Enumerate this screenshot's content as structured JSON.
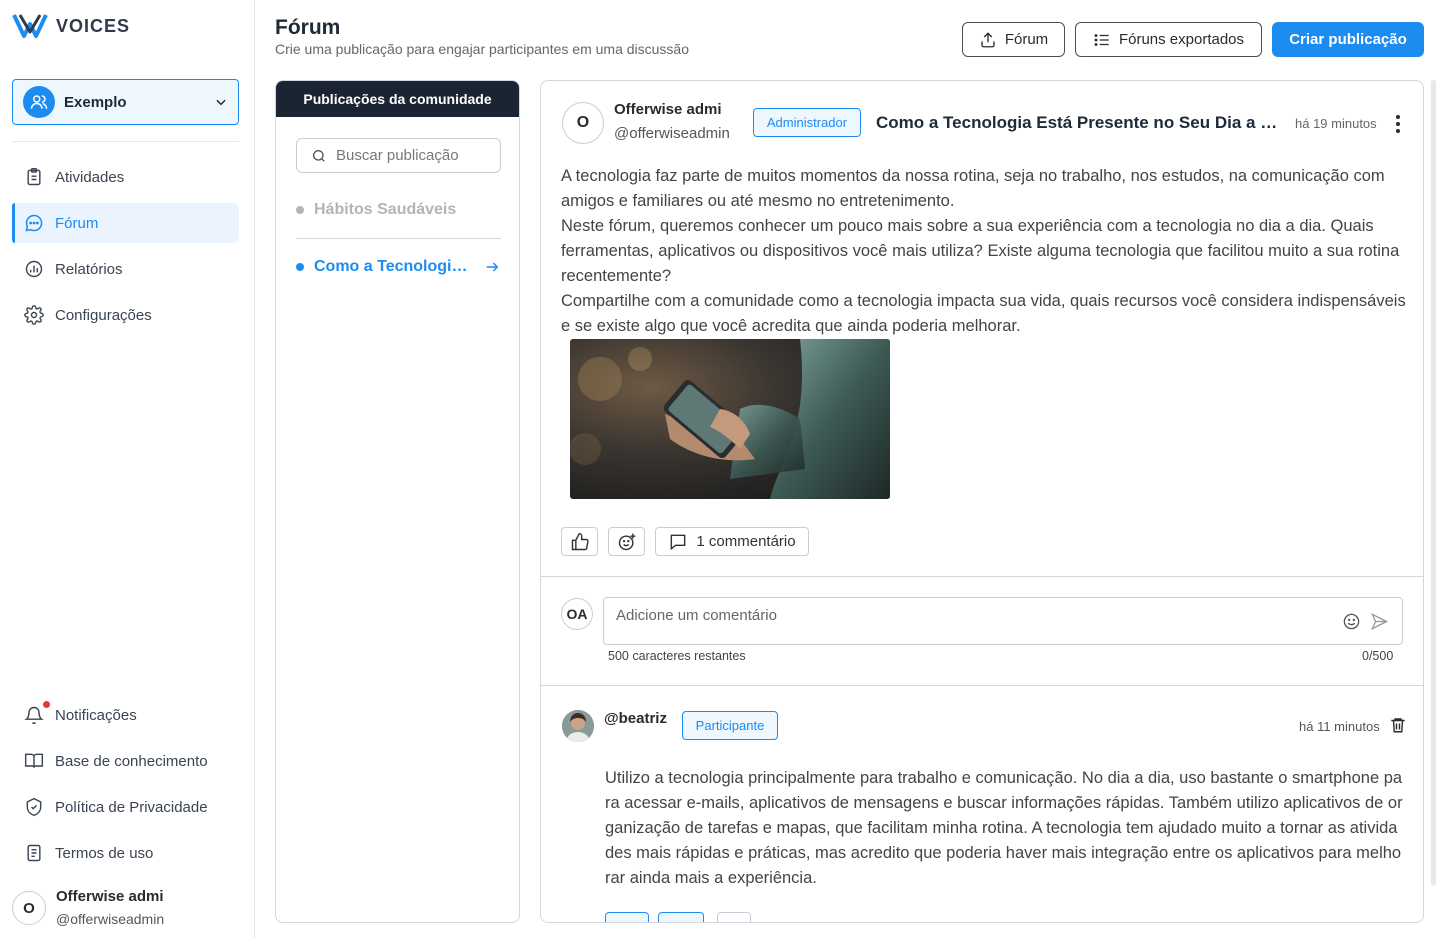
{
  "brand": {
    "name": "VOICES",
    "accent": "#1d8cf0",
    "dark": "#1b2433"
  },
  "sidebar": {
    "workspace": "Exemplo",
    "nav": [
      {
        "label": "Atividades",
        "icon": "clipboard-icon"
      },
      {
        "label": "Fórum",
        "icon": "chat-icon",
        "active": true
      },
      {
        "label": "Relatórios",
        "icon": "chart-icon"
      },
      {
        "label": "Configurações",
        "icon": "gear-icon"
      }
    ],
    "bottom_nav": [
      {
        "label": "Notificações",
        "icon": "bell-icon"
      },
      {
        "label": "Base de conhecimento",
        "icon": "book-icon"
      },
      {
        "label": "Política de Privacidade",
        "icon": "shield-icon"
      },
      {
        "label": "Termos de uso",
        "icon": "document-icon"
      }
    ],
    "user": {
      "initial": "O",
      "name": "Offerwise admi",
      "handle": "@offerwiseadmin"
    }
  },
  "header": {
    "title": "Fórum",
    "subtitle": "Crie uma publicação para engajar participantes em uma discussão",
    "buttons": {
      "export": "Fórum",
      "exported": "Fóruns exportados",
      "create": "Criar publicação"
    }
  },
  "list_panel": {
    "title": "Publicações da comunidade",
    "search_placeholder": "Buscar publicação",
    "items": [
      {
        "label": "Hábitos Saudáveis",
        "color": "#b0b5bc"
      },
      {
        "label": "Como a Tecnologia Está Presente no Seu Dia a Dia",
        "color": "#1d8cf0",
        "selected": true
      }
    ]
  },
  "post": {
    "avatar_initial": "O",
    "author": "Offerwise admi",
    "handle": "@offerwiseadmin",
    "badge": "Administrador",
    "title": "Como a Tecnologia Está Presente no Seu Dia a Dia",
    "time": "há 19 minutos",
    "body": [
      "A tecnologia faz parte de muitos momentos da nossa rotina, seja no trabalho, nos estudos, na comunicação com amigos e familiares ou até mesmo no entretenimento.",
      "Neste fórum, queremos conhecer um pouco mais sobre a sua experiência com a tecnologia no dia a dia. Quais ferramentas, aplicativos ou dispositivos você mais utiliza? Existe alguma tecnologia que facilitou muito a sua rotina recentemente?",
      "Compartilhe com a comunidade como a tecnologia impacta sua vida, quais recursos você considera indispensáveis e se existe algo que você acredita que ainda poderia melhorar."
    ],
    "comments_label": "1 commentário"
  },
  "composer": {
    "avatar_initials": "OA",
    "placeholder": "Adicione um comentário",
    "chars_left": "500 caracteres restantes",
    "count": "0/500"
  },
  "comment": {
    "author": "@beatriz",
    "badge": "Participante",
    "time": "há 11 minutos",
    "body": "Utilizo a tecnologia principalmente para trabalho e comunicação. No dia a dia, uso bastante o smartphone para acessar e-mails, aplicativos de mensagens e buscar informações rápidas. Também utilizo aplicativos de organização de tarefas e mapas, que facilitam minha rotina. A tecnologia tem ajudado muito a tornar as atividades mais rápidas e práticas, mas acredito que poderia haver mais integração entre os aplicativos para melhorar ainda mais a experiência."
  }
}
